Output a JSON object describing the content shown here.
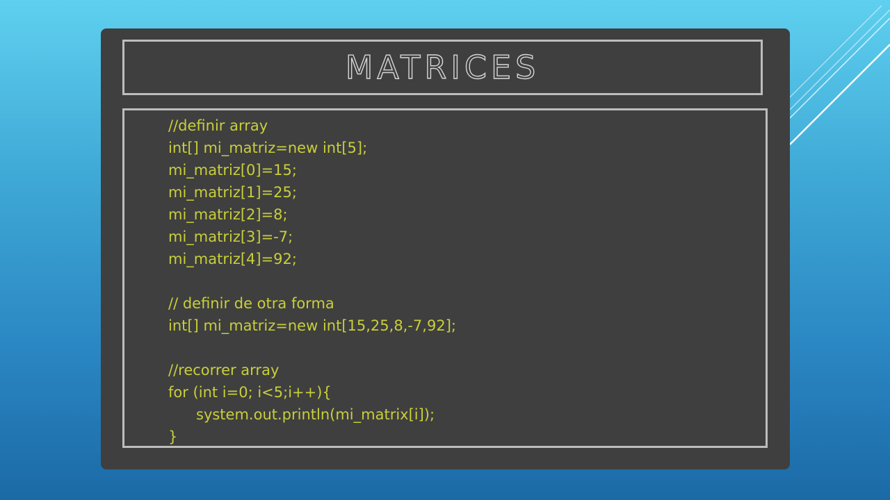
{
  "slide": {
    "title": "MATRICES",
    "code_lines": [
      "//definir array",
      "int[] mi_matriz=new int[5];",
      "mi_matriz[0]=15;",
      "mi_matriz[1]=25;",
      "mi_matriz[2]=8;",
      "mi_matriz[3]=-7;",
      "mi_matriz[4]=92;",
      "",
      "// definir de otra forma",
      "int[] mi_matriz=new int[15,25,8,-7,92];",
      "",
      "//recorrer array",
      "for (int i=0; i<5;i++){",
      "system.out.println(mi_matrix[i]);",
      "}"
    ]
  },
  "colors": {
    "background_top": "#5fd0ef",
    "background_bottom": "#1b6aa6",
    "board": "#3f3f3f",
    "frame": "#bdbdbd",
    "code_text": "#c8cf3a",
    "title_outline": "#d6d6d6"
  }
}
